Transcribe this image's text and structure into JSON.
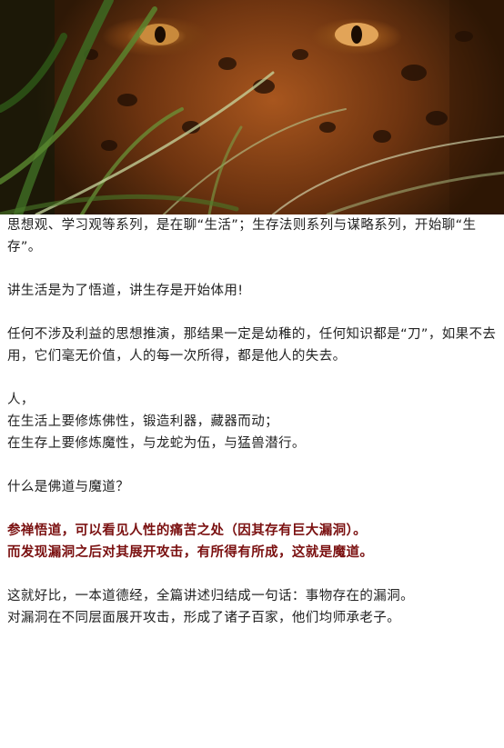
{
  "paragraphs": [
    {
      "lines": [
        "思想观、学习观等系列，是在聊“生活”；生存法则系列与谋略系列，开始聊“生存”。"
      ]
    },
    {
      "lines": [
        "讲生活是为了悟道，讲生存是开始体用!"
      ]
    },
    {
      "lines": [
        "任何不涉及利益的思想推演，那结果一定是幼稚的，任何知识都是“刀”，如果不去用，它们毫无价值，人的每一次所得，都是他人的失去。"
      ]
    },
    {
      "lines": [
        "人，",
        "在生活上要修炼佛性，锻造利器，藏器而动；",
        "在生存上要修炼魔性，与龙蛇为伍，与猛兽潜行。"
      ]
    },
    {
      "lines": [
        "什么是佛道与魔道？"
      ]
    },
    {
      "lines": [
        "参禅悟道，可以看见人性的痛苦之处（因其存有巨大漏洞）。",
        "而发现漏洞之后对其展开攻击，有所得有所成，这就是魔道。"
      ],
      "emphasis": true
    },
    {
      "lines": [
        "这就好比，一本道德经，全篇讲述归结成一句话：事物存在的漏洞。",
        "对漏洞在不同层面展开攻击，形成了诸子百家，他们均师承老子。"
      ]
    }
  ],
  "colors": {
    "emphasis": "#7a1010",
    "body_text": "#222222"
  }
}
